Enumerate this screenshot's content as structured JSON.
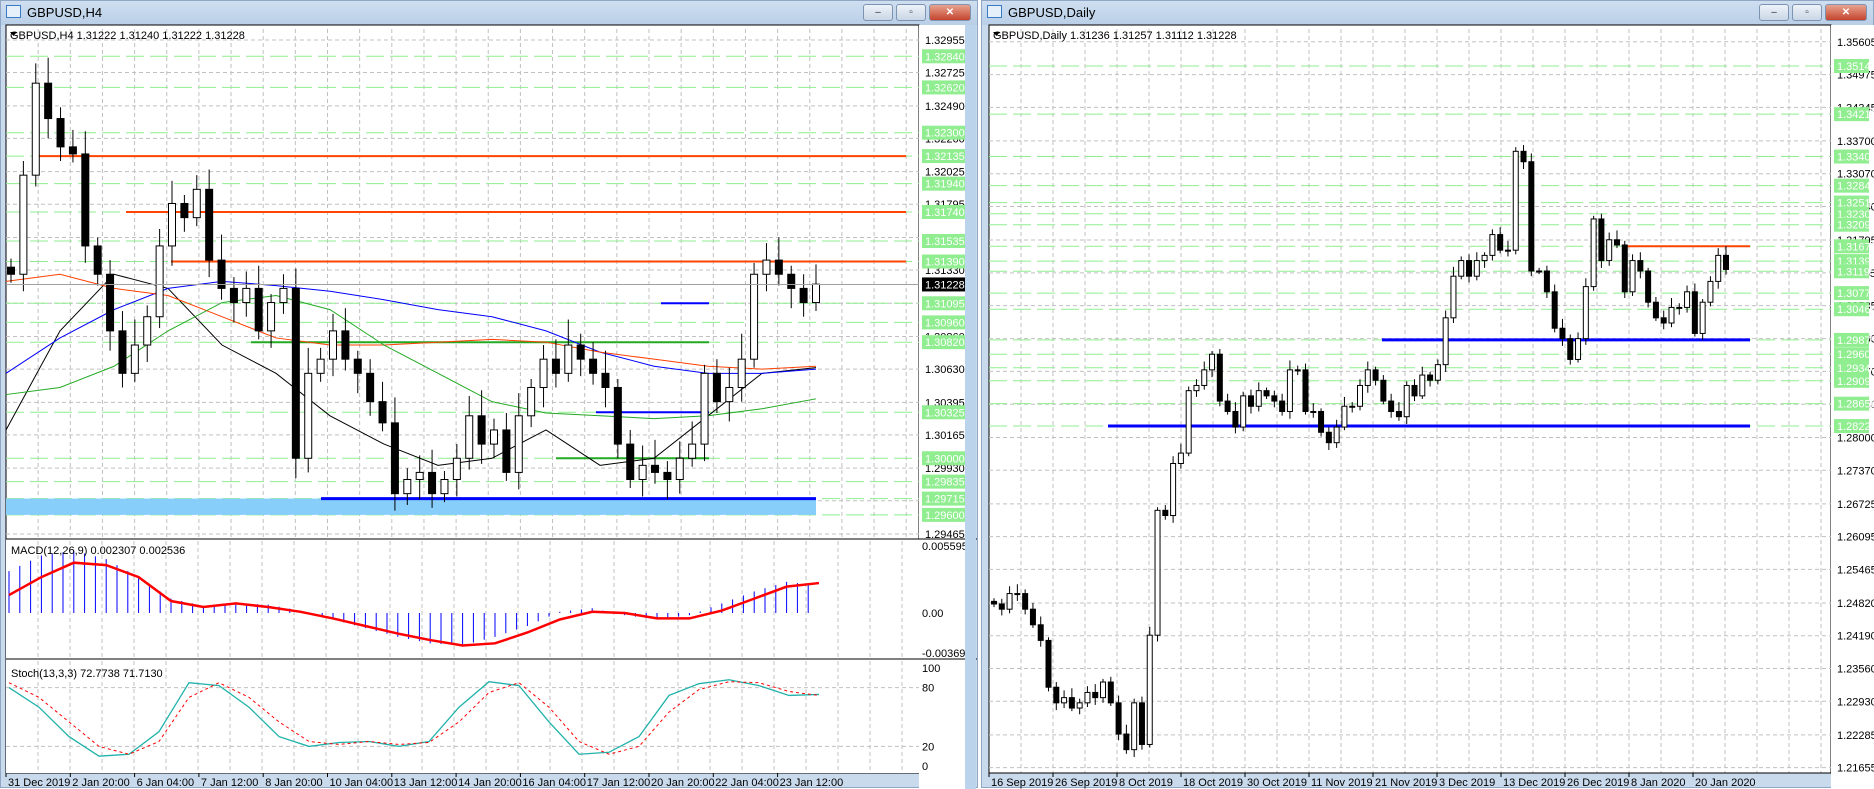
{
  "left": {
    "title": "GBPUSD,H4",
    "info": "GBPUSD,H4  1.31222 1.31240 1.31222 1.31228",
    "buttons": {
      "minimize": "–",
      "restore": "▫",
      "close": "✕"
    },
    "price_ticks": [
      "1.32955",
      "1.32725",
      "1.32490",
      "1.32260",
      "1.32025",
      "1.31795",
      "1.31560",
      "1.31330",
      "1.31095",
      "1.30860",
      "1.30630",
      "1.30395",
      "1.30165",
      "1.29930",
      "1.29700",
      "1.29465"
    ],
    "level_labels": [
      "1.32840",
      "1.32620",
      "1.32300",
      "1.32135",
      "1.31940",
      "1.31740",
      "1.31535",
      "1.31390",
      "1.31095",
      "1.30960",
      "1.30820",
      "1.30325",
      "1.30000",
      "1.29835",
      "1.29715",
      "1.29600"
    ],
    "current_price": "1.31228",
    "resistance_lines": [
      1.32135,
      1.3174,
      1.3139
    ],
    "blue_lines": [
      1.31095,
      1.30325
    ],
    "green_lines": [
      1.3082,
      1.3
    ],
    "support_zone": {
      "top": 1.29715,
      "bottom": 1.296
    },
    "time_labels": [
      "31 Dec 2019",
      "2 Jan 20:00",
      "6 Jan 04:00",
      "7 Jan 12:00",
      "8 Jan 20:00",
      "10 Jan 04:00",
      "13 Jan 12:00",
      "14 Jan 20:00",
      "16 Jan 04:00",
      "17 Jan 12:00",
      "20 Jan 20:00",
      "22 Jan 04:00",
      "23 Jan 12:00"
    ],
    "closes": [
      1.313,
      1.32,
      1.3265,
      1.324,
      1.322,
      1.3215,
      1.315,
      1.313,
      1.309,
      1.306,
      1.308,
      1.31,
      1.315,
      1.318,
      1.317,
      1.319,
      1.314,
      1.312,
      1.311,
      1.312,
      1.309,
      1.311,
      1.312,
      1.3,
      1.306,
      1.307,
      1.309,
      1.307,
      1.306,
      1.304,
      1.3025,
      1.2975,
      1.2985,
      1.299,
      1.2975,
      1.2985,
      1.3,
      1.303,
      1.301,
      1.302,
      1.299,
      1.303,
      1.305,
      1.307,
      1.306,
      1.308,
      1.307,
      1.306,
      1.305,
      1.301,
      1.2985,
      1.2995,
      1.299,
      1.2985,
      1.3,
      1.301,
      1.306,
      1.304,
      1.305,
      1.307,
      1.313,
      1.314,
      1.313,
      1.312,
      1.311,
      1.3123
    ],
    "moving_averages": [
      {
        "color": "#000000",
        "values": [
          1.302,
          1.309,
          1.313,
          1.312,
          1.308,
          1.306,
          1.303,
          1.301,
          1.2995,
          1.3,
          1.302,
          1.2995,
          1.3,
          1.303,
          1.306,
          1.3064
        ]
      },
      {
        "color": "#0000ff",
        "values": [
          1.306,
          1.3085,
          1.3105,
          1.312,
          1.3125,
          1.3122,
          1.3118,
          1.3112,
          1.3105,
          1.31,
          1.309,
          1.3075,
          1.3065,
          1.306,
          1.306,
          1.3063
        ]
      },
      {
        "color": "#ff4000",
        "values": [
          1.3125,
          1.313,
          1.312,
          1.3115,
          1.31,
          1.3085,
          1.308,
          1.308,
          1.3082,
          1.3084,
          1.3082,
          1.3075,
          1.307,
          1.3065,
          1.3063,
          1.3065
        ]
      },
      {
        "color": "#22aa22",
        "values": [
          1.3045,
          1.305,
          1.3065,
          1.309,
          1.311,
          1.3115,
          1.3105,
          1.308,
          1.306,
          1.304,
          1.3032,
          1.303,
          1.3028,
          1.303,
          1.3035,
          1.3042
        ]
      }
    ],
    "macd": {
      "label": "MACD(12,26,9) 0.002307 0.002536",
      "ticks": [
        "0.005595",
        "0.00",
        "-0.003695"
      ],
      "histogram": [
        0.0035,
        0.0048,
        0.0052,
        0.0045,
        0.003,
        0.0012,
        0.0006,
        0.0008,
        0.0007,
        0.0002,
        -0.0006,
        -0.0014,
        -0.0022,
        -0.0028,
        -0.003,
        -0.0022,
        -0.0012,
        0.0001,
        0.0004,
        -0.0002,
        -0.0006,
        -0.0002,
        0.0008,
        0.0018,
        0.0026,
        0.0023
      ],
      "signal": [
        0.0015,
        0.003,
        0.0042,
        0.004,
        0.003,
        0.001,
        0.0005,
        0.0008,
        0.0005,
        0.0001,
        -0.0005,
        -0.0012,
        -0.0019,
        -0.0025,
        -0.003,
        -0.0028,
        -0.0018,
        -0.0006,
        0.0001,
        0.0,
        -0.0005,
        -0.0005,
        0.0002,
        0.0012,
        0.0022,
        0.0025
      ]
    },
    "stoch": {
      "label": "Stoch(13,3,3) 72.7738 71.7130",
      "ticks": [
        "100",
        "80",
        "20",
        "0"
      ],
      "k": [
        80,
        60,
        30,
        10,
        12,
        35,
        85,
        82,
        60,
        30,
        20,
        24,
        25,
        20,
        25,
        60,
        86,
        82,
        45,
        12,
        14,
        30,
        72,
        84,
        88,
        82,
        72,
        73
      ],
      "d": [
        85,
        70,
        45,
        20,
        12,
        25,
        70,
        85,
        70,
        45,
        25,
        22,
        25,
        22,
        24,
        45,
        75,
        85,
        60,
        25,
        12,
        20,
        55,
        78,
        86,
        85,
        76,
        72
      ]
    }
  },
  "right": {
    "title": "GBPUSD,Daily",
    "info": "GBPUSD,Daily  1.31236 1.31257 1.31112 1.31228",
    "buttons": {
      "minimize": "–",
      "restore": "▫",
      "close": "✕"
    },
    "price_ticks": [
      "1.35605",
      "1.34975",
      "1.34345",
      "1.33700",
      "1.33070",
      "1.32440",
      "1.31795",
      "1.31165",
      "1.30535",
      "1.29900",
      "1.29270",
      "1.28640",
      "1.28000",
      "1.27370",
      "1.26725",
      "1.26095",
      "1.25465",
      "1.24820",
      "1.24190",
      "1.23560",
      "1.22930",
      "1.22285",
      "1.21655"
    ],
    "level_labels": [
      "1.35140",
      "1.34215",
      "1.33400",
      "1.32840",
      "1.32515",
      "1.32300",
      "1.32090",
      "1.31675",
      "1.31390",
      "1.31195",
      "1.30775",
      "1.30465",
      "1.29875",
      "1.29600",
      "1.29340",
      "1.29090",
      "1.28650",
      "1.28220"
    ],
    "resistance_lines": [
      1.31675
    ],
    "blue_lines": [
      1.29875,
      1.2822
    ],
    "time_labels": [
      "16 Sep 2019",
      "26 Sep 2019",
      "8 Oct 2019",
      "18 Oct 2019",
      "30 Oct 2019",
      "11 Nov 2019",
      "21 Nov 2019",
      "3 Dec 2019",
      "13 Dec 2019",
      "26 Dec 2019",
      "8 Jan 2020",
      "20 Jan 2020"
    ],
    "closes": [
      1.248,
      1.247,
      1.25,
      1.25,
      1.247,
      1.244,
      1.241,
      1.232,
      1.229,
      1.23,
      1.228,
      1.229,
      1.231,
      1.23,
      1.233,
      1.229,
      1.223,
      1.22,
      1.229,
      1.221,
      1.242,
      1.266,
      1.265,
      1.275,
      1.277,
      1.289,
      1.29,
      1.293,
      1.296,
      1.287,
      1.285,
      1.282,
      1.288,
      1.286,
      1.289,
      1.288,
      1.287,
      1.285,
      1.293,
      1.293,
      1.285,
      1.285,
      1.281,
      1.279,
      1.282,
      1.286,
      1.286,
      1.29,
      1.293,
      1.291,
      1.287,
      1.285,
      1.284,
      1.29,
      1.288,
      1.292,
      1.291,
      1.294,
      1.303,
      1.311,
      1.314,
      1.311,
      1.314,
      1.315,
      1.319,
      1.316,
      1.316,
      1.335,
      1.333,
      1.312,
      1.312,
      1.308,
      1.301,
      1.299,
      1.295,
      1.299,
      1.309,
      1.322,
      1.314,
      1.318,
      1.317,
      1.308,
      1.314,
      1.312,
      1.306,
      1.303,
      1.302,
      1.305,
      1.305,
      1.308,
      1.3,
      1.306,
      1.31,
      1.315,
      1.3123
    ]
  },
  "colors": {
    "level_label_bg": "#90ee90",
    "resistance": "#ff4500",
    "support": "#0000ff",
    "zone": "#87cefa",
    "grid": "#c0c0c0"
  }
}
